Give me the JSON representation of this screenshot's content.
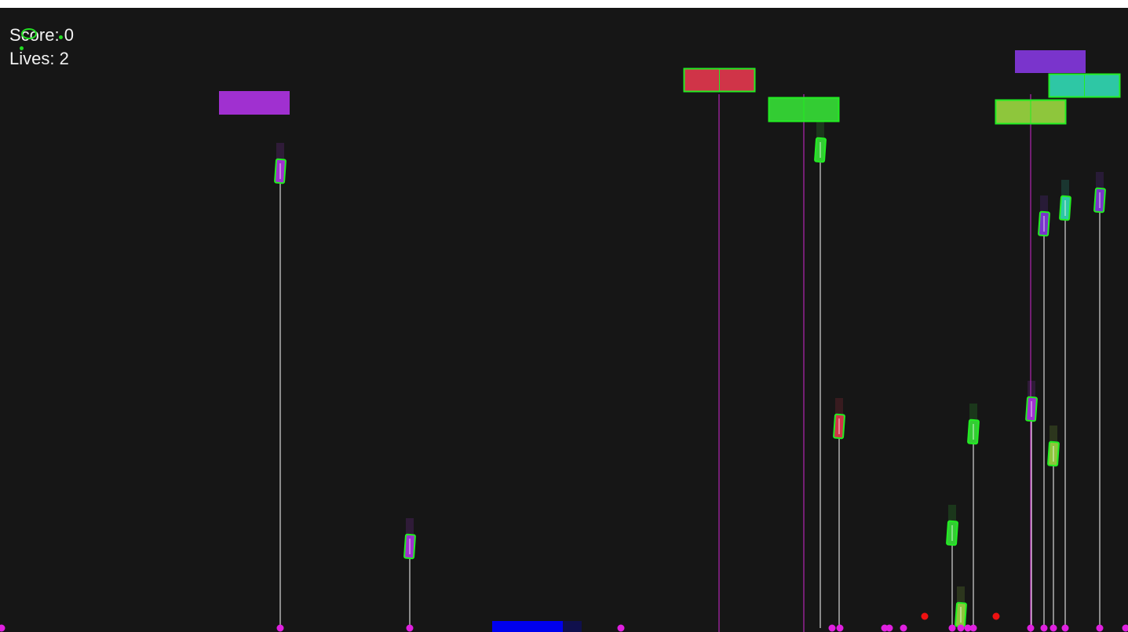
{
  "hud": {
    "score_label": "Score: 0",
    "lives_label": "Lives: 2",
    "score": 0,
    "lives": 2
  },
  "colors": {
    "background": "#161616",
    "hud_text": "#f2f2f2",
    "outline": "#22ee22",
    "ground_marker": "#e020e0",
    "projectile": "#ee1111",
    "player": "#0000ee",
    "rope_white": "#ffffff",
    "rope_magenta": "#d028d0"
  },
  "player": {
    "color": "#0000ee"
  },
  "enemy_ships": [
    {
      "id": "purple-left",
      "color": "#a030d0",
      "outlined": false
    },
    {
      "id": "red-center",
      "color": "#d03448",
      "outlined": true
    },
    {
      "id": "green-center",
      "color": "#33cc33",
      "outlined": true
    },
    {
      "id": "violet-right",
      "color": "#7a34cc",
      "outlined": false
    },
    {
      "id": "teal-right",
      "color": "#2ec7a5",
      "outlined": true
    },
    {
      "id": "lime-right",
      "color": "#8ec63c",
      "outlined": true
    }
  ],
  "hooks": [
    {
      "color": "#a030d0"
    },
    {
      "color": "#a030d0"
    },
    {
      "color": "#33cc33"
    },
    {
      "color": "#d03448"
    },
    {
      "color": "#33cc33"
    },
    {
      "color": "#33cc33"
    },
    {
      "color": "#a030d0"
    },
    {
      "color": "#7a34cc"
    },
    {
      "color": "#2ec7a5"
    },
    {
      "color": "#8ec63c"
    },
    {
      "color": "#8ec63c"
    },
    {
      "color": "#7a34cc"
    }
  ]
}
